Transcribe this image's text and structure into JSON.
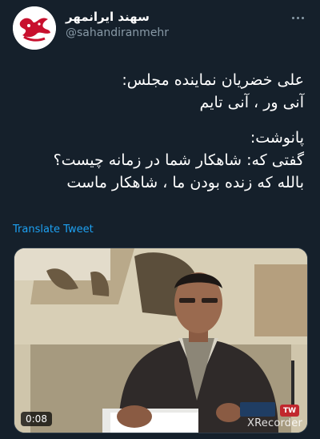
{
  "user": {
    "display_name": "سهند ایرانمهر",
    "handle": "@sahandiranmehr",
    "avatar": "red-calligraphy-logo"
  },
  "tweet": {
    "lines": [
      "علی خضریان نماینده مجلس:",
      "آنی ور ، آنی تایم",
      "پانوشت:",
      "گفتی که: شاهکار شما در زمانه چیست؟",
      "بالله که زنده بودن ما ، شاهکار ماست"
    ],
    "translate_label": "Translate Tweet"
  },
  "media": {
    "duration": "0:08",
    "watermark": "XRecorder",
    "channel_badge": "TW"
  },
  "icons": {
    "more": "more-dots-icon"
  },
  "colors": {
    "background": "#15202b",
    "link": "#1da1f2",
    "secondary_text": "#8899a6"
  }
}
